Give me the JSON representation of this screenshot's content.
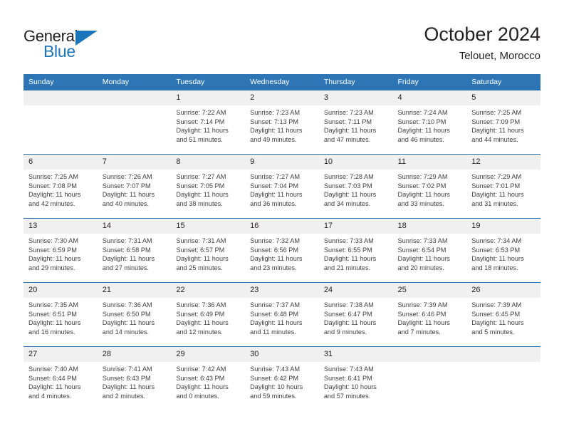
{
  "brand": {
    "name_top": "General",
    "name_bottom": "Blue",
    "triangle_color": "#1b75bb",
    "text_color": "#231f20"
  },
  "header": {
    "title": "October 2024",
    "subtitle": "Telouet, Morocco"
  },
  "theme": {
    "header_bg": "#2e75b6",
    "header_text": "#ffffff",
    "daynum_bg": "#f0f0f0",
    "cell_bg": "#ffffff",
    "row_divider": "#2e75b6",
    "body_text": "#3f3f3f"
  },
  "calendar": {
    "weekday_headers": [
      "Sunday",
      "Monday",
      "Tuesday",
      "Wednesday",
      "Thursday",
      "Friday",
      "Saturday"
    ],
    "weeks": [
      [
        {
          "day": "",
          "sunrise": "",
          "sunset": "",
          "daylight_line1": "",
          "daylight_line2": ""
        },
        {
          "day": "",
          "sunrise": "",
          "sunset": "",
          "daylight_line1": "",
          "daylight_line2": ""
        },
        {
          "day": "1",
          "sunrise": "Sunrise: 7:22 AM",
          "sunset": "Sunset: 7:14 PM",
          "daylight_line1": "Daylight: 11 hours",
          "daylight_line2": "and 51 minutes."
        },
        {
          "day": "2",
          "sunrise": "Sunrise: 7:23 AM",
          "sunset": "Sunset: 7:13 PM",
          "daylight_line1": "Daylight: 11 hours",
          "daylight_line2": "and 49 minutes."
        },
        {
          "day": "3",
          "sunrise": "Sunrise: 7:23 AM",
          "sunset": "Sunset: 7:11 PM",
          "daylight_line1": "Daylight: 11 hours",
          "daylight_line2": "and 47 minutes."
        },
        {
          "day": "4",
          "sunrise": "Sunrise: 7:24 AM",
          "sunset": "Sunset: 7:10 PM",
          "daylight_line1": "Daylight: 11 hours",
          "daylight_line2": "and 46 minutes."
        },
        {
          "day": "5",
          "sunrise": "Sunrise: 7:25 AM",
          "sunset": "Sunset: 7:09 PM",
          "daylight_line1": "Daylight: 11 hours",
          "daylight_line2": "and 44 minutes."
        }
      ],
      [
        {
          "day": "6",
          "sunrise": "Sunrise: 7:25 AM",
          "sunset": "Sunset: 7:08 PM",
          "daylight_line1": "Daylight: 11 hours",
          "daylight_line2": "and 42 minutes."
        },
        {
          "day": "7",
          "sunrise": "Sunrise: 7:26 AM",
          "sunset": "Sunset: 7:07 PM",
          "daylight_line1": "Daylight: 11 hours",
          "daylight_line2": "and 40 minutes."
        },
        {
          "day": "8",
          "sunrise": "Sunrise: 7:27 AM",
          "sunset": "Sunset: 7:05 PM",
          "daylight_line1": "Daylight: 11 hours",
          "daylight_line2": "and 38 minutes."
        },
        {
          "day": "9",
          "sunrise": "Sunrise: 7:27 AM",
          "sunset": "Sunset: 7:04 PM",
          "daylight_line1": "Daylight: 11 hours",
          "daylight_line2": "and 36 minutes."
        },
        {
          "day": "10",
          "sunrise": "Sunrise: 7:28 AM",
          "sunset": "Sunset: 7:03 PM",
          "daylight_line1": "Daylight: 11 hours",
          "daylight_line2": "and 34 minutes."
        },
        {
          "day": "11",
          "sunrise": "Sunrise: 7:29 AM",
          "sunset": "Sunset: 7:02 PM",
          "daylight_line1": "Daylight: 11 hours",
          "daylight_line2": "and 33 minutes."
        },
        {
          "day": "12",
          "sunrise": "Sunrise: 7:29 AM",
          "sunset": "Sunset: 7:01 PM",
          "daylight_line1": "Daylight: 11 hours",
          "daylight_line2": "and 31 minutes."
        }
      ],
      [
        {
          "day": "13",
          "sunrise": "Sunrise: 7:30 AM",
          "sunset": "Sunset: 6:59 PM",
          "daylight_line1": "Daylight: 11 hours",
          "daylight_line2": "and 29 minutes."
        },
        {
          "day": "14",
          "sunrise": "Sunrise: 7:31 AM",
          "sunset": "Sunset: 6:58 PM",
          "daylight_line1": "Daylight: 11 hours",
          "daylight_line2": "and 27 minutes."
        },
        {
          "day": "15",
          "sunrise": "Sunrise: 7:31 AM",
          "sunset": "Sunset: 6:57 PM",
          "daylight_line1": "Daylight: 11 hours",
          "daylight_line2": "and 25 minutes."
        },
        {
          "day": "16",
          "sunrise": "Sunrise: 7:32 AM",
          "sunset": "Sunset: 6:56 PM",
          "daylight_line1": "Daylight: 11 hours",
          "daylight_line2": "and 23 minutes."
        },
        {
          "day": "17",
          "sunrise": "Sunrise: 7:33 AM",
          "sunset": "Sunset: 6:55 PM",
          "daylight_line1": "Daylight: 11 hours",
          "daylight_line2": "and 21 minutes."
        },
        {
          "day": "18",
          "sunrise": "Sunrise: 7:33 AM",
          "sunset": "Sunset: 6:54 PM",
          "daylight_line1": "Daylight: 11 hours",
          "daylight_line2": "and 20 minutes."
        },
        {
          "day": "19",
          "sunrise": "Sunrise: 7:34 AM",
          "sunset": "Sunset: 6:53 PM",
          "daylight_line1": "Daylight: 11 hours",
          "daylight_line2": "and 18 minutes."
        }
      ],
      [
        {
          "day": "20",
          "sunrise": "Sunrise: 7:35 AM",
          "sunset": "Sunset: 6:51 PM",
          "daylight_line1": "Daylight: 11 hours",
          "daylight_line2": "and 16 minutes."
        },
        {
          "day": "21",
          "sunrise": "Sunrise: 7:36 AM",
          "sunset": "Sunset: 6:50 PM",
          "daylight_line1": "Daylight: 11 hours",
          "daylight_line2": "and 14 minutes."
        },
        {
          "day": "22",
          "sunrise": "Sunrise: 7:36 AM",
          "sunset": "Sunset: 6:49 PM",
          "daylight_line1": "Daylight: 11 hours",
          "daylight_line2": "and 12 minutes."
        },
        {
          "day": "23",
          "sunrise": "Sunrise: 7:37 AM",
          "sunset": "Sunset: 6:48 PM",
          "daylight_line1": "Daylight: 11 hours",
          "daylight_line2": "and 11 minutes."
        },
        {
          "day": "24",
          "sunrise": "Sunrise: 7:38 AM",
          "sunset": "Sunset: 6:47 PM",
          "daylight_line1": "Daylight: 11 hours",
          "daylight_line2": "and 9 minutes."
        },
        {
          "day": "25",
          "sunrise": "Sunrise: 7:39 AM",
          "sunset": "Sunset: 6:46 PM",
          "daylight_line1": "Daylight: 11 hours",
          "daylight_line2": "and 7 minutes."
        },
        {
          "day": "26",
          "sunrise": "Sunrise: 7:39 AM",
          "sunset": "Sunset: 6:45 PM",
          "daylight_line1": "Daylight: 11 hours",
          "daylight_line2": "and 5 minutes."
        }
      ],
      [
        {
          "day": "27",
          "sunrise": "Sunrise: 7:40 AM",
          "sunset": "Sunset: 6:44 PM",
          "daylight_line1": "Daylight: 11 hours",
          "daylight_line2": "and 4 minutes."
        },
        {
          "day": "28",
          "sunrise": "Sunrise: 7:41 AM",
          "sunset": "Sunset: 6:43 PM",
          "daylight_line1": "Daylight: 11 hours",
          "daylight_line2": "and 2 minutes."
        },
        {
          "day": "29",
          "sunrise": "Sunrise: 7:42 AM",
          "sunset": "Sunset: 6:43 PM",
          "daylight_line1": "Daylight: 11 hours",
          "daylight_line2": "and 0 minutes."
        },
        {
          "day": "30",
          "sunrise": "Sunrise: 7:43 AM",
          "sunset": "Sunset: 6:42 PM",
          "daylight_line1": "Daylight: 10 hours",
          "daylight_line2": "and 59 minutes."
        },
        {
          "day": "31",
          "sunrise": "Sunrise: 7:43 AM",
          "sunset": "Sunset: 6:41 PM",
          "daylight_line1": "Daylight: 10 hours",
          "daylight_line2": "and 57 minutes."
        },
        {
          "day": "",
          "sunrise": "",
          "sunset": "",
          "daylight_line1": "",
          "daylight_line2": ""
        },
        {
          "day": "",
          "sunrise": "",
          "sunset": "",
          "daylight_line1": "",
          "daylight_line2": ""
        }
      ]
    ]
  }
}
